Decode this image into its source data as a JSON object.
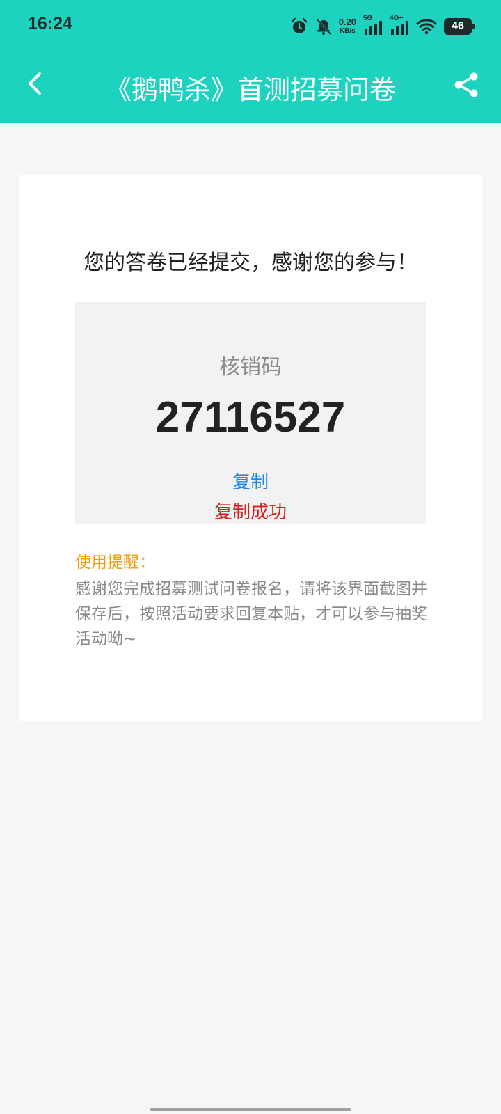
{
  "status_bar": {
    "time": "16:24",
    "net_speed_value": "0.20",
    "net_speed_unit": "KB/s",
    "signal_1_label": "5G",
    "signal_2_label": "4G+",
    "battery": "46"
  },
  "header": {
    "title": "《鹅鸭杀》首测招募问卷",
    "background_color": "#1dd3bf"
  },
  "result": {
    "message": "您的答卷已经提交，感谢您的参与！",
    "code_label": "核销码",
    "code_value": "27116527",
    "copy_label": "复制",
    "copy_status": "复制成功"
  },
  "reminder": {
    "title": "使用提醒：",
    "text": "感谢您完成招募测试问卷报名，请将该界面截图并保存后，按照活动要求回复本贴，才可以参与抽奖活动呦~"
  }
}
